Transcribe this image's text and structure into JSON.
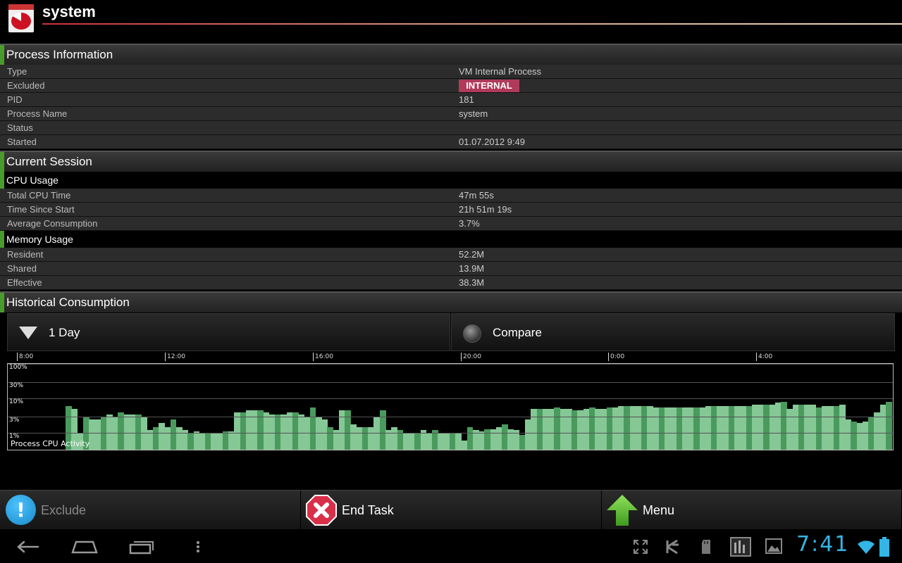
{
  "app": {
    "title": "system"
  },
  "process_info": {
    "header": "Process Information",
    "rows": [
      {
        "label": "Type",
        "value": "VM Internal Process"
      },
      {
        "label": "Excluded",
        "value": "INTERNAL"
      },
      {
        "label": "PID",
        "value": "181"
      },
      {
        "label": "Process Name",
        "value": "system"
      },
      {
        "label": "Status",
        "value": ""
      },
      {
        "label": "Started",
        "value": "01.07.2012 9:49"
      }
    ]
  },
  "current_session": {
    "header": "Current Session",
    "cpu": {
      "header": "CPU Usage",
      "rows": [
        {
          "label": "Total CPU Time",
          "value": "47m 55s"
        },
        {
          "label": "Time Since Start",
          "value": "21h 51m 19s"
        },
        {
          "label": "Average Consumption",
          "value": "3.7%"
        }
      ]
    },
    "memory": {
      "header": "Memory Usage",
      "rows": [
        {
          "label": "Resident",
          "value": "52.2M"
        },
        {
          "label": "Shared",
          "value": "13.9M"
        },
        {
          "label": "Effective",
          "value": "38.3M"
        }
      ]
    }
  },
  "historical": {
    "header": "Historical Consumption",
    "range_label": "1 Day",
    "compare_label": "Compare",
    "colors": {
      "bar_dark": "#4a9a5e",
      "bar_light": "#86c796"
    }
  },
  "chart_data": {
    "type": "bar",
    "caption": "Process CPU Activity",
    "x_ticks": [
      "8:00",
      "12:00",
      "16:00",
      "20:00",
      "0:00",
      "4:00"
    ],
    "y_ticks": [
      "100%",
      "30%",
      "10%",
      "3%",
      "1%"
    ],
    "y_scale": "log",
    "ylim": [
      0.3,
      100
    ],
    "values": [
      6,
      5,
      1,
      3,
      2.5,
      2.5,
      3,
      3.5,
      3,
      4,
      3.5,
      3.5,
      3.5,
      3,
      1.2,
      1.5,
      2,
      1.5,
      2.5,
      1.5,
      1.2,
      1,
      1.1,
      1,
      1,
      1,
      1,
      1.1,
      1.1,
      4,
      4,
      4.5,
      4.5,
      4.5,
      4,
      3.5,
      3.5,
      3.5,
      4,
      4,
      3.5,
      3,
      5.5,
      3,
      2.5,
      1.5,
      1.2,
      4.5,
      4.5,
      1.8,
      1.5,
      1.5,
      1.5,
      3,
      4.5,
      1.2,
      1.5,
      1.2,
      1,
      1,
      1,
      1.2,
      1,
      1.2,
      1,
      1,
      1,
      1,
      0.6,
      1.5,
      1.2,
      1.1,
      1.3,
      1.3,
      1.5,
      1.8,
      1.3,
      1.2,
      0.9,
      2.5,
      5,
      5,
      5,
      5,
      5.5,
      5,
      5,
      4.5,
      4.5,
      5,
      5.5,
      5,
      5,
      5.5,
      5.5,
      6,
      6,
      6,
      6,
      6,
      6,
      5.5,
      5.5,
      5.5,
      5.5,
      5.5,
      5.5,
      5.5,
      5.5,
      5.5,
      6,
      6,
      6,
      6,
      6,
      6,
      6,
      6,
      6.5,
      6.5,
      6.5,
      6.5,
      7.5,
      8,
      5,
      6.5,
      6.5,
      6.5,
      6.5,
      5.5,
      6,
      6,
      6,
      6.5,
      2.5,
      2.2,
      2,
      2.2,
      3,
      4,
      6.5,
      8
    ]
  },
  "actions": {
    "exclude": "Exclude",
    "end_task": "End Task",
    "menu": "Menu"
  },
  "statusbar": {
    "time": "7:41"
  }
}
